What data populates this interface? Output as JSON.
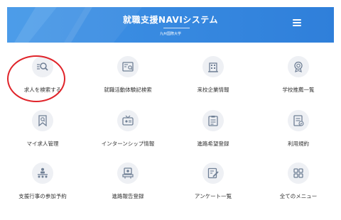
{
  "header": {
    "title": "就職支援NAVIシステム",
    "subtitle": "九州国際大学",
    "menu_icon": "hamburger-icon",
    "bg_color": "#3a8be2"
  },
  "menu": [
    {
      "label": "求人を検索する",
      "icon": "search-icon",
      "highlighted": true
    },
    {
      "label": "就職活動体験記検索",
      "icon": "document-search-icon"
    },
    {
      "label": "来校企業情報",
      "icon": "building-icon"
    },
    {
      "label": "学校推薦一覧",
      "icon": "medal-icon"
    },
    {
      "label": "マイ求人管理",
      "icon": "favorite-search-icon"
    },
    {
      "label": "インターンシップ情報",
      "icon": "tv-icon"
    },
    {
      "label": "進路希望登録",
      "icon": "clipboard-icon"
    },
    {
      "label": "利用規約",
      "icon": "terms-icon"
    },
    {
      "label": "支援行事の参加予約",
      "icon": "presentation-icon"
    },
    {
      "label": "進路報告登録",
      "icon": "report-icon"
    },
    {
      "label": "アンケート一覧",
      "icon": "survey-icon"
    },
    {
      "label": "全てのメニュー",
      "icon": "grid-icon"
    }
  ],
  "colors": {
    "accent": "#3a8be2",
    "icon_bg": "#eef0f4",
    "highlight": "#e0242a"
  }
}
